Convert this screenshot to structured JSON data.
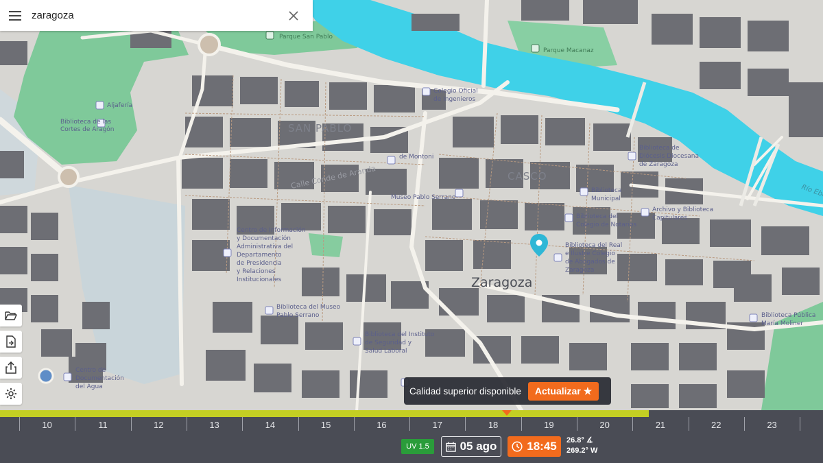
{
  "search": {
    "value": "zaragoza",
    "placeholder": ""
  },
  "map": {
    "city_label": "Zaragoza",
    "districts": [
      "SAN PABLO",
      "CASCO"
    ],
    "streets": [
      "Calle Conde de Aranda"
    ],
    "river": "Río Ebro",
    "places": [
      "Biblioteca de las Cortes de Aragón",
      "Biblioteca de Aljafería",
      "Parque San Pablo",
      "Parque Macanaz",
      "Biblioteca del Colegio Oficial de Ingenieros",
      "Biblioteca de Diócesis Diocesana de Zaragoza",
      "Centro de Información y Documentación Administrativa del Departamento de Presidencia y Relaciones Institucionales",
      "Museo Pablo Serrano",
      "Biblioteca de Montoni",
      "Biblioteca Municipal",
      "Biblioteca del Colegio de Notarios",
      "Biblioteca del Real e Ilustre Colegio de Abogados de Zaragoza",
      "Archivo y Biblioteca Capitulares",
      "Biblioteca del Museo Pablo Serrano",
      "Biblioteca del Instituto de Seguridad y Salud Laboral",
      "Centro de Documentación del Agua",
      "Biblioteca Pública María Moliner"
    ]
  },
  "banner": {
    "text": "Calidad superior disponible",
    "button": "Actualizar ★"
  },
  "timeline": {
    "hours": [
      "10",
      "11",
      "12",
      "13",
      "14",
      "15",
      "16",
      "17",
      "18",
      "19",
      "20",
      "21",
      "22",
      "23"
    ],
    "progress_fraction": 0.788,
    "current_hour_fraction": 18.25
  },
  "controls": {
    "uv": "UV 1.5",
    "date": "05 ago",
    "time": "18:45",
    "sun_altitude": "26.8° ∡",
    "sun_azimuth": "269.2° W"
  },
  "colors": {
    "accent": "#f26b1d",
    "progress": "#c4cf23",
    "uv_badge": "#2a9c3a",
    "river": "#3fd1e8",
    "park": "#63c08a",
    "timeline_bg": "#4a4c55"
  },
  "icons": {
    "menu": "hamburger-icon",
    "clear": "close-icon",
    "folder": "folder-open-icon",
    "export": "export-file-icon",
    "share": "share-icon",
    "settings": "gear-icon",
    "pin": "location-pin-icon",
    "calendar": "calendar-icon",
    "clock": "clock-icon"
  }
}
